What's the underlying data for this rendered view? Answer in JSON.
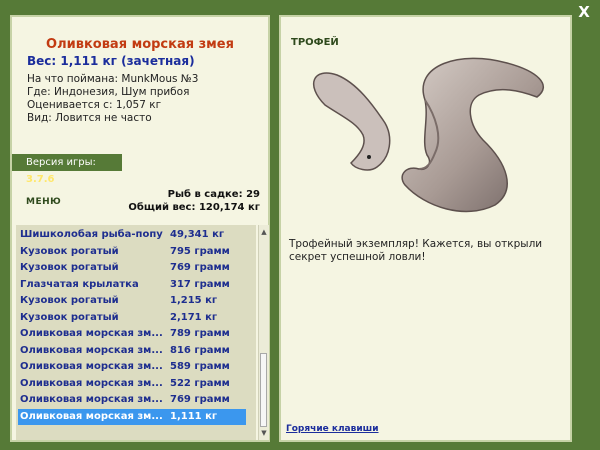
{
  "close_label": "X",
  "fish": {
    "title": "Оливковая морская змея",
    "weight": "Вес: 1,111 кг (зачетная)",
    "bait": "На что поймана: MunkMous №3",
    "location": "Где: Индонезия, Шум прибоя",
    "valued": "Оценивается с: 1,057 кг",
    "kind": "Вид: Ловится не часто"
  },
  "version": {
    "label": "Версия игры:",
    "value": "3.7.6"
  },
  "menu_label": "МЕНЮ",
  "stats": {
    "caught": "Рыб в садке: 29",
    "total_weight": "Общий вес: 120,174 кг"
  },
  "catch_list": [
    {
      "name": "Шишколобая рыба-попу...",
      "weight": "49,341 кг"
    },
    {
      "name": "Кузовок рогатый",
      "weight": "795 грамм"
    },
    {
      "name": "Кузовок рогатый",
      "weight": "769 грамм"
    },
    {
      "name": "Глазчатая крылатка",
      "weight": "317 грамм"
    },
    {
      "name": "Кузовок рогатый",
      "weight": "1,215 кг"
    },
    {
      "name": "Кузовок рогатый",
      "weight": "2,171 кг"
    },
    {
      "name": "Оливковая морская зм...",
      "weight": "789 грамм"
    },
    {
      "name": "Оливковая морская зм...",
      "weight": "816 грамм"
    },
    {
      "name": "Оливковая морская зм...",
      "weight": "589 грамм"
    },
    {
      "name": "Оливковая морская зм...",
      "weight": "522 грамм"
    },
    {
      "name": "Оливковая морская зм...",
      "weight": "769 грамм"
    },
    {
      "name": "Оливковая морская зм...",
      "weight": "1,111 кг"
    }
  ],
  "selected_index": 11,
  "trophy": {
    "label": "ТРОФЕЙ",
    "message": "Трофейный экземпляр! Кажется, вы открыли секрет успешной ловли!"
  },
  "hotkeys_label": "Горячие клавиши",
  "colors": {
    "frame_green": "#567a37",
    "panel_bg": "#f5f5e2",
    "title_red": "#c23b12",
    "accent_blue": "#1b2d9c",
    "selection_blue": "#3b97ee"
  }
}
